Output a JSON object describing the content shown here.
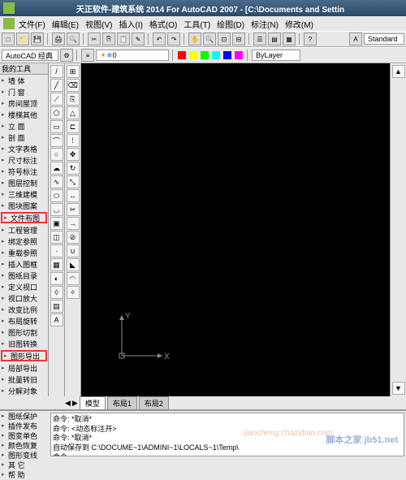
{
  "title": "天正软件-建筑系统 2014 For AutoCAD 2007 - [C:\\Documents and Settin",
  "menus": [
    "文件(F)",
    "编辑(E)",
    "视图(V)",
    "插入(I)",
    "格式(O)",
    "工具(T)",
    "绘图(D)",
    "标注(N)",
    "修改(M)"
  ],
  "tb2_text": "AutoCAD 经典",
  "tb3_standard": "Standard",
  "layer_prop": "ByLayer",
  "left_header": "我的工具",
  "left_items": [
    {
      "t": "墙 体",
      "hl": false
    },
    {
      "t": "门 窗",
      "hl": false
    },
    {
      "t": "房间屋顶",
      "hl": false
    },
    {
      "t": "楼梯其他",
      "hl": false
    },
    {
      "t": "立 面",
      "hl": false
    },
    {
      "t": "剖 面",
      "hl": false
    },
    {
      "t": "文字表格",
      "hl": false
    },
    {
      "t": "尺寸标注",
      "hl": false
    },
    {
      "t": "符号标注",
      "hl": false
    },
    {
      "t": "图层控制",
      "hl": false
    },
    {
      "t": "三维建模",
      "hl": false
    },
    {
      "t": "图块图案",
      "hl": false
    },
    {
      "t": "文件布图",
      "hl": true
    },
    {
      "t": "工程管理",
      "hl": false
    },
    {
      "t": "绑定参照",
      "hl": false
    },
    {
      "t": "重载参照",
      "hl": false
    },
    {
      "t": "插入图框",
      "hl": false
    },
    {
      "t": "图纸目录",
      "hl": false
    },
    {
      "t": "定义视口",
      "hl": false
    },
    {
      "t": "视口放大",
      "hl": false
    },
    {
      "t": "改变比例",
      "hl": false
    },
    {
      "t": "布局旋转",
      "hl": false
    },
    {
      "t": "图形切割",
      "hl": false
    },
    {
      "t": "旧图转换",
      "hl": false
    },
    {
      "t": "图形导出",
      "hl": true
    },
    {
      "t": "局部导出",
      "hl": false
    },
    {
      "t": "批量转旧",
      "hl": false
    },
    {
      "t": "分解对象",
      "hl": false
    }
  ],
  "left_items_bottom": [
    {
      "t": "图纸保护"
    },
    {
      "t": "插件发布"
    },
    {
      "t": "图变单色"
    },
    {
      "t": "颜色恢复"
    },
    {
      "t": "图形变线"
    },
    {
      "t": "其 它"
    },
    {
      "t": "帮 助"
    }
  ],
  "tabs": [
    "模型",
    "布局1",
    "布局2"
  ],
  "ucs": {
    "x": "X",
    "y": "Y"
  },
  "cmd_lines": [
    "命令: *取消*",
    "命令: <动态标注开>",
    "命令: *取消*",
    "自动保存到 C:\\DOCUME~1\\ADMINI~1\\LOCALS~1\\Temp\\",
    "命令:"
  ],
  "watermark": "脚本之家 jb51.net",
  "watermark2": "jiaocheng.chazidian.com"
}
